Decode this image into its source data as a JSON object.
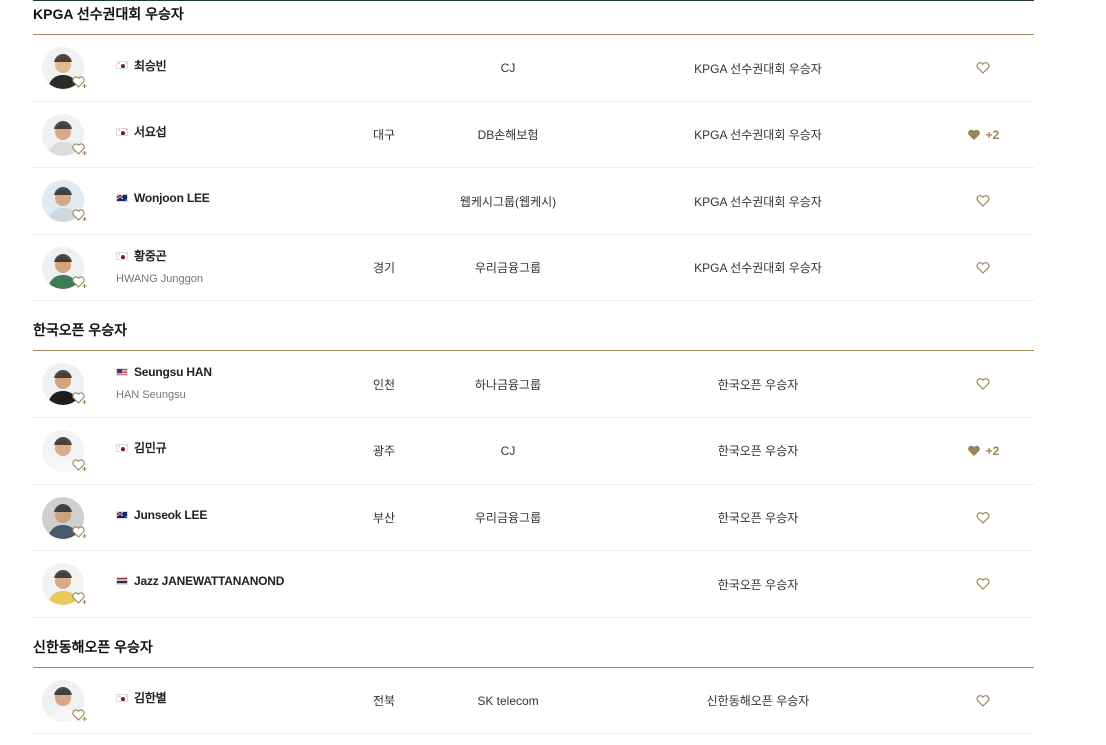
{
  "sections": [
    {
      "title": "KPGA 선수권대회 우승자",
      "players": [
        {
          "flag": "KR",
          "name": "최승빈",
          "ename": "",
          "region": "",
          "sponsor": "CJ",
          "award": "KPGA 선수권대회 우승자",
          "liked": false,
          "like_count": ""
        },
        {
          "flag": "KR",
          "name": "서요섭",
          "ename": "",
          "region": "대구",
          "sponsor": "DB손해보험",
          "award": "KPGA 선수권대회 우승자",
          "liked": true,
          "like_count": "+2"
        },
        {
          "flag": "AU",
          "name": "Wonjoon LEE",
          "ename": "",
          "region": "",
          "sponsor": "웹케시그룹(웹케시)",
          "award": "KPGA 선수권대회 우승자",
          "liked": false,
          "like_count": ""
        },
        {
          "flag": "KR",
          "name": "황중곤",
          "ename": "HWANG Junggon",
          "region": "경기",
          "sponsor": "우리금융그룹",
          "award": "KPGA 선수권대회 우승자",
          "liked": false,
          "like_count": ""
        }
      ]
    },
    {
      "title": "한국오픈 우승자",
      "players": [
        {
          "flag": "US",
          "name": "Seungsu HAN",
          "ename": "HAN Seungsu",
          "region": "인천",
          "sponsor": "하나금융그룹",
          "award": "한국오픈 우승자",
          "liked": false,
          "like_count": ""
        },
        {
          "flag": "KR",
          "name": "김민규",
          "ename": "",
          "region": "광주",
          "sponsor": "CJ",
          "award": "한국오픈 우승자",
          "liked": true,
          "like_count": "+2"
        },
        {
          "flag": "AU",
          "name": "Junseok LEE",
          "ename": "",
          "region": "부산",
          "sponsor": "우리금융그룹",
          "award": "한국오픈 우승자",
          "liked": false,
          "like_count": ""
        },
        {
          "flag": "TH",
          "name": "Jazz JANEWATTANANOND",
          "ename": "",
          "region": "",
          "sponsor": "",
          "award": "한국오픈 우승자",
          "liked": false,
          "like_count": ""
        }
      ]
    },
    {
      "title": "신한동해오픈 우승자",
      "players": [
        {
          "flag": "KR",
          "name": "김한별",
          "ename": "",
          "region": "전북",
          "sponsor": "SK telecom",
          "award": "신한동해오픈 우승자",
          "liked": false,
          "like_count": ""
        }
      ]
    }
  ],
  "colors": {
    "accent": "#9b8558",
    "rule": "#a08a5c",
    "top_rule": "#1f3b2b"
  }
}
